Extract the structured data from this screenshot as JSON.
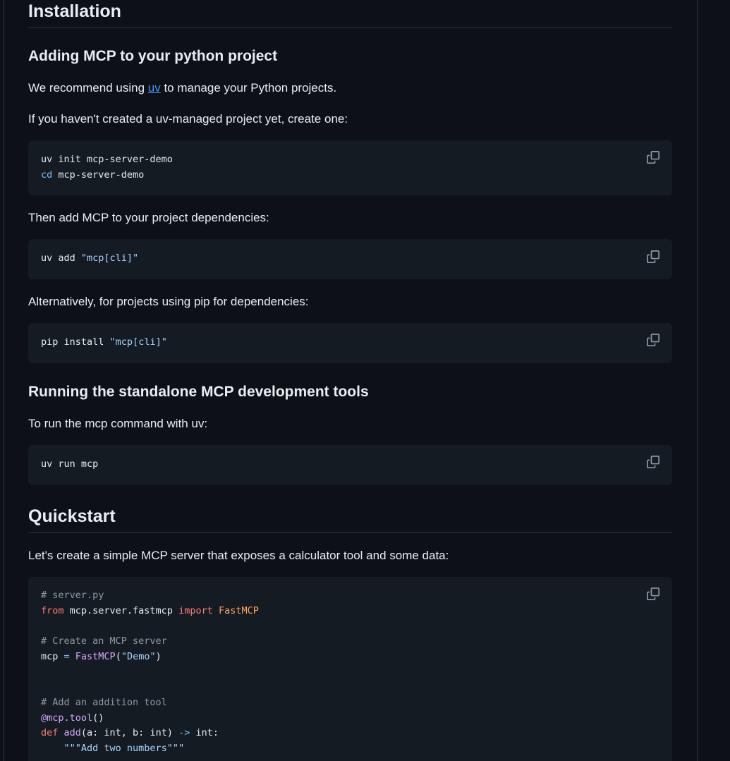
{
  "installation": {
    "title": "Installation",
    "adding": {
      "title": "Adding MCP to your python project",
      "recommend_prefix": "We recommend using ",
      "recommend_link": "uv",
      "recommend_suffix": " to manage your Python projects.",
      "create_text": "If you haven't created a uv-managed project yet, create one:",
      "code1": {
        "line1": "uv init mcp-server-demo",
        "line2_cmd": "cd",
        "line2_rest": " mcp-server-demo"
      },
      "add_text": "Then add MCP to your project dependencies:",
      "code2": {
        "cmd": "uv add ",
        "arg": "\"mcp[cli]\""
      },
      "alt_text": "Alternatively, for projects using pip for dependencies:",
      "code3": {
        "cmd": "pip install ",
        "arg": "\"mcp[cli]\""
      }
    },
    "running": {
      "title": "Running the standalone MCP development tools",
      "text": "To run the mcp command with uv:",
      "code": "uv run mcp"
    }
  },
  "quickstart": {
    "title": "Quickstart",
    "text": "Let's create a simple MCP server that exposes a calculator tool and some data:",
    "code": {
      "c1": "# server.py",
      "from": "from",
      "module": " mcp.server.fastmcp ",
      "import": "import",
      "cls": " FastMCP",
      "c2": "# Create an MCP server",
      "var": "mcp ",
      "eq": "=",
      "call": " FastMCP",
      "arg_open": "(",
      "arg": "\"Demo\"",
      "arg_close": ")",
      "c3": "# Add an addition tool",
      "decorator": "@mcp.tool",
      "decorator_parens": "()",
      "def": "def",
      "fn": " add",
      "params": "(a: int, b: int) ",
      "arrow": "->",
      "ret": " int:",
      "docstring": "    \"\"\"Add two numbers\"\"\""
    }
  },
  "icons": {
    "copy": "copy-icon"
  }
}
